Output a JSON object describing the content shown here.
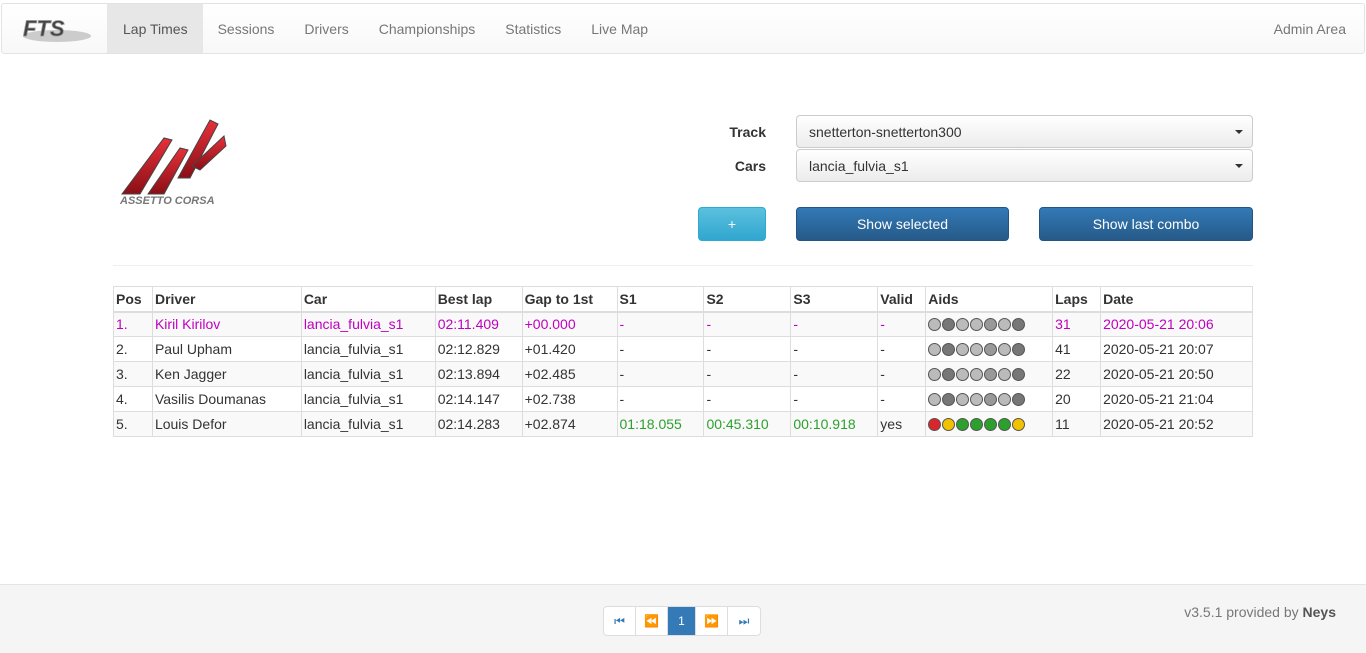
{
  "nav": {
    "brand": "FTS",
    "items": [
      {
        "label": "Lap Times",
        "active": true
      },
      {
        "label": "Sessions",
        "active": false
      },
      {
        "label": "Drivers",
        "active": false
      },
      {
        "label": "Championships",
        "active": false
      },
      {
        "label": "Statistics",
        "active": false
      },
      {
        "label": "Live Map",
        "active": false
      }
    ],
    "admin": "Admin Area"
  },
  "logo_text": "ASSETTO CORSA",
  "form": {
    "track_label": "Track",
    "track_value": "snetterton-snetterton300",
    "cars_label": "Cars",
    "cars_value": "lancia_fulvia_s1",
    "plus_label": "+",
    "show_selected_label": "Show selected",
    "show_last_label": "Show last combo"
  },
  "table": {
    "headers": [
      "Pos",
      "Driver",
      "Car",
      "Best lap",
      "Gap to 1st",
      "S1",
      "S2",
      "S3",
      "Valid",
      "Aids",
      "Laps",
      "Date"
    ],
    "rows": [
      [
        "1.",
        "Kiril Kirilov",
        "lancia_fulvia_s1",
        "02:11.409",
        "+00.000",
        "-",
        "-",
        "-",
        "-",
        "",
        "31",
        "2020-05-21 20:06"
      ],
      [
        "2.",
        "Paul Upham",
        "lancia_fulvia_s1",
        "02:12.829",
        "+01.420",
        "-",
        "-",
        "-",
        "-",
        "",
        "41",
        "2020-05-21 20:07"
      ],
      [
        "3.",
        "Ken Jagger",
        "lancia_fulvia_s1",
        "02:13.894",
        "+02.485",
        "-",
        "-",
        "-",
        "-",
        "",
        "22",
        "2020-05-21 20:50"
      ],
      [
        "4.",
        "Vasilis Doumanas",
        "lancia_fulvia_s1",
        "02:14.147",
        "+02.738",
        "-",
        "-",
        "-",
        "-",
        "",
        "20",
        "2020-05-21 21:04"
      ],
      [
        "5.",
        "Louis Defor",
        "lancia_fulvia_s1",
        "02:14.283",
        "+02.874",
        "01:18.055",
        "00:45.310",
        "00:10.918",
        "yes",
        "",
        "11",
        "2020-05-21 20:52"
      ]
    ]
  },
  "colors": {
    "leader": "#c000c0",
    "sector_green": "#2ca02c",
    "primary": "#337ab7",
    "info": "#5bc0de"
  },
  "footer": {
    "pager": [
      "first-page-icon",
      "prev-page-icon",
      "1",
      "next-page-icon",
      "last-page-icon"
    ],
    "version_prefix": "v3.5.1 provided by ",
    "version_author": "Neys"
  }
}
